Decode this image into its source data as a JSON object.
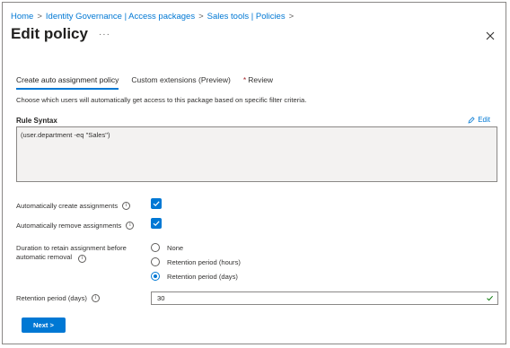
{
  "breadcrumb": {
    "items": [
      "Home",
      "Identity Governance | Access packages",
      "Sales tools | Policies"
    ],
    "separator": ">"
  },
  "header": {
    "title": "Edit policy",
    "more_label": "···"
  },
  "tabs": [
    {
      "label": "Create auto assignment policy",
      "active": true
    },
    {
      "label": "Custom extensions (Preview)",
      "active": false
    },
    {
      "label": "Review",
      "required": true,
      "active": false
    }
  ],
  "description": "Choose which users will automatically get access to this package based on specific filter criteria.",
  "rule_syntax": {
    "label": "Rule Syntax",
    "edit_label": "Edit",
    "value": "(user.department -eq \"Sales\")"
  },
  "auto_create": {
    "label": "Automatically create assignments",
    "checked": true
  },
  "auto_remove": {
    "label": "Automatically remove assignments",
    "checked": true
  },
  "duration": {
    "label": "Duration to retain assignment before automatic removal",
    "options": [
      "None",
      "Retention period (hours)",
      "Retention period (days)"
    ],
    "selected": "Retention period (days)"
  },
  "retention": {
    "label": "Retention period (days)",
    "value": "30"
  },
  "next_button": "Next >",
  "colors": {
    "accent": "#0078d4",
    "valid": "#107c10",
    "required": "#a4262c"
  }
}
